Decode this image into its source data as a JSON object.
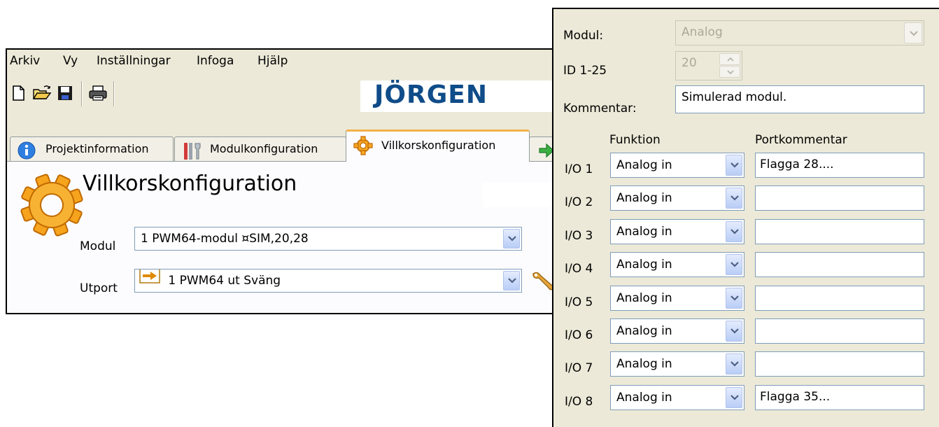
{
  "menubar": {
    "items": [
      "Arkiv",
      "Vy",
      "Inställningar",
      "Infoga",
      "Hjälp"
    ]
  },
  "toolbar": {
    "icons": [
      "new-document-icon",
      "open-folder-icon",
      "save-icon",
      "print-icon"
    ]
  },
  "brand": {
    "logo_text": "JÖRGEN"
  },
  "tabs": [
    {
      "label": "Projektinformation",
      "icon": "info-icon",
      "active": false
    },
    {
      "label": "Modulkonfiguration",
      "icon": "tools-icon",
      "active": false
    },
    {
      "label": "Villkorskonfiguration",
      "icon": "gear-icon",
      "active": true
    },
    {
      "label": "",
      "icon": "green-arrow-icon",
      "active": false
    }
  ],
  "page": {
    "title": "Villkorskonfiguration",
    "modul_label": "Modul",
    "modul_value": "1 PWM64-modul  ¤SIM,20,28",
    "utport_label": "Utport",
    "utport_value": "1  PWM64 ut  Sväng"
  },
  "module_dialog": {
    "modul_label": "Modul:",
    "modul_value": "Analog",
    "id_label": "ID  1-25",
    "id_value": "20",
    "kommentar_label": "Kommentar:",
    "kommentar_value": "Simulerad modul.",
    "funktion_header": "Funktion",
    "portkommentar_header": "Portkommentar",
    "io_rows": [
      {
        "label": "I/O 1",
        "funktion": "Analog in",
        "kommentar": "Flagga 28...."
      },
      {
        "label": "I/O 2",
        "funktion": "Analog in",
        "kommentar": ""
      },
      {
        "label": "I/O 3",
        "funktion": "Analog in",
        "kommentar": ""
      },
      {
        "label": "I/O 4",
        "funktion": "Analog in",
        "kommentar": ""
      },
      {
        "label": "I/O 5",
        "funktion": "Analog in",
        "kommentar": ""
      },
      {
        "label": "I/O 6",
        "funktion": "Analog in",
        "kommentar": ""
      },
      {
        "label": "I/O 7",
        "funktion": "Analog in",
        "kommentar": ""
      },
      {
        "label": "I/O 8",
        "funktion": "Analog in",
        "kommentar": "Flagga 35..."
      }
    ]
  },
  "colors": {
    "window_bg": "#ece9d8",
    "brand_blue": "#0f4c89",
    "active_tab_accent": "#f3b24a",
    "input_border": "#7f9db9"
  }
}
